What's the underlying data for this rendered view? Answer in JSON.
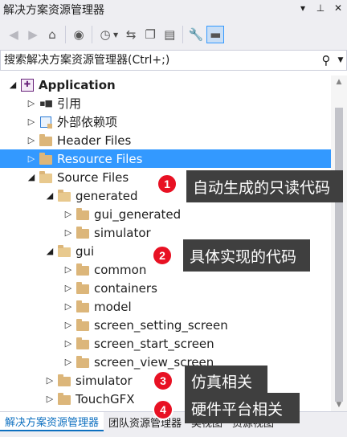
{
  "window": {
    "title": "解决方案资源管理器"
  },
  "title_controls": [
    "▾",
    "⊥",
    "✕"
  ],
  "toolbar": {
    "buttons": [
      {
        "name": "back",
        "glyph": "◀",
        "disabled": true
      },
      {
        "name": "forward",
        "glyph": "▶",
        "disabled": true
      },
      {
        "name": "home",
        "glyph": "⌂",
        "disabled": false
      },
      {
        "name": "switch-views",
        "glyph": "◉",
        "disabled": false
      },
      {
        "name": "pending-changes",
        "glyph": "◷",
        "disabled": false
      },
      {
        "name": "sync-active-doc",
        "glyph": "⇆",
        "disabled": false
      },
      {
        "name": "collapse-all",
        "glyph": "❐",
        "disabled": false
      },
      {
        "name": "show-all-files",
        "glyph": "▤",
        "disabled": false
      },
      {
        "name": "properties",
        "glyph": "🔧",
        "disabled": false
      },
      {
        "name": "preview",
        "glyph": "▬",
        "disabled": false
      }
    ]
  },
  "search": {
    "placeholder": "搜索解决方案资源管理器(Ctrl+;)"
  },
  "tree": {
    "items": [
      {
        "label": "Application",
        "level": 0,
        "arrow": "◢",
        "icon": "app",
        "bold": true,
        "selected": false
      },
      {
        "label": "引用",
        "level": 1,
        "arrow": "▷",
        "icon": "refs",
        "bold": false,
        "selected": false
      },
      {
        "label": "外部依赖项",
        "level": 1,
        "arrow": "▷",
        "icon": "external",
        "bold": false,
        "selected": false
      },
      {
        "label": "Header Files",
        "level": 1,
        "arrow": "▷",
        "icon": "filter",
        "bold": false,
        "selected": false
      },
      {
        "label": "Resource Files",
        "level": 1,
        "arrow": "▷",
        "icon": "filter",
        "bold": false,
        "selected": true
      },
      {
        "label": "Source Files",
        "level": 1,
        "arrow": "◢",
        "icon": "filter-open",
        "bold": false,
        "selected": false
      },
      {
        "label": "generated",
        "level": 2,
        "arrow": "◢",
        "icon": "filter-open",
        "bold": false,
        "selected": false
      },
      {
        "label": "gui_generated",
        "level": 3,
        "arrow": "▷",
        "icon": "filter",
        "bold": false,
        "selected": false
      },
      {
        "label": "simulator",
        "level": 3,
        "arrow": "▷",
        "icon": "filter",
        "bold": false,
        "selected": false
      },
      {
        "label": "gui",
        "level": 2,
        "arrow": "◢",
        "icon": "filter-open",
        "bold": false,
        "selected": false
      },
      {
        "label": "common",
        "level": 3,
        "arrow": "▷",
        "icon": "filter",
        "bold": false,
        "selected": false
      },
      {
        "label": "containers",
        "level": 3,
        "arrow": "▷",
        "icon": "filter",
        "bold": false,
        "selected": false
      },
      {
        "label": "model",
        "level": 3,
        "arrow": "▷",
        "icon": "filter",
        "bold": false,
        "selected": false
      },
      {
        "label": "screen_setting_screen",
        "level": 3,
        "arrow": "▷",
        "icon": "filter",
        "bold": false,
        "selected": false
      },
      {
        "label": "screen_start_screen",
        "level": 3,
        "arrow": "▷",
        "icon": "filter",
        "bold": false,
        "selected": false
      },
      {
        "label": "screen_view_screen",
        "level": 3,
        "arrow": "▷",
        "icon": "filter",
        "bold": false,
        "selected": false
      },
      {
        "label": "simulator",
        "level": 2,
        "arrow": "▷",
        "icon": "filter",
        "bold": false,
        "selected": false
      },
      {
        "label": "TouchGFX",
        "level": 2,
        "arrow": "▷",
        "icon": "filter",
        "bold": false,
        "selected": false
      }
    ]
  },
  "scrollbar": {
    "up": "▲",
    "down": "▼"
  },
  "tabs": [
    {
      "label": "解决方案资源管理器",
      "active": true
    },
    {
      "label": "团队资源管理器",
      "active": false
    },
    {
      "label": "类视图",
      "active": false
    },
    {
      "label": "资源视图",
      "active": false
    }
  ],
  "annotations": [
    {
      "number": "1",
      "text": "自动生成的只读代码"
    },
    {
      "number": "2",
      "text": "具体实现的代码"
    },
    {
      "number": "3",
      "text": "仿真相关"
    },
    {
      "number": "4",
      "text": "硬件平台相关"
    }
  ],
  "colors": {
    "selection": "#3399ff",
    "chrome": "#eeeef2",
    "folder": "#dcb67a",
    "badge": "#e81123",
    "callout": "#3f3f3f",
    "active_tab_text": "#0e70c0"
  }
}
